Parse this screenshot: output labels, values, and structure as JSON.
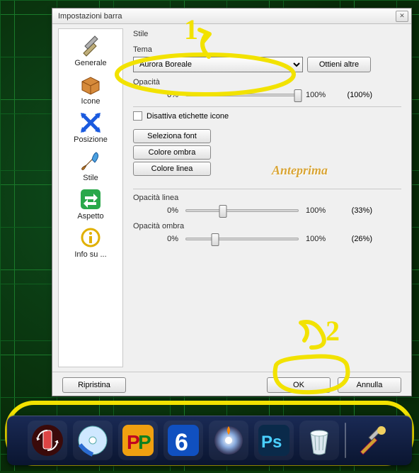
{
  "dialog": {
    "title": "Impostazioni barra",
    "close_glyph": "✕"
  },
  "sidebar": {
    "items": [
      {
        "id": "generale",
        "label": "Generale"
      },
      {
        "id": "icone",
        "label": "Icone"
      },
      {
        "id": "posizione",
        "label": "Posizione"
      },
      {
        "id": "stile",
        "label": "Stile"
      },
      {
        "id": "aspetto",
        "label": "Aspetto"
      },
      {
        "id": "info",
        "label": "Info su ..."
      }
    ]
  },
  "style_panel": {
    "group_title": "Stile",
    "theme_label": "Tema",
    "theme_value": "Aurora Boreale",
    "get_more_label": "Ottieni altre",
    "opacity_label": "Opacità",
    "opacity_0": "0%",
    "opacity_100": "100%",
    "opacity_value_text": "(100%)",
    "opacity_percent": 100,
    "disable_labels_checked": false,
    "disable_labels_text": "Disattiva etichette icone",
    "select_font_label": "Seleziona font",
    "shadow_color_label": "Colore ombra",
    "line_color_label": "Colore linea",
    "preview_text": "Anteprima",
    "line_opacity_label": "Opacità linea",
    "line_opacity_value_text": "(33%)",
    "line_opacity_percent": 33,
    "shadow_opacity_label": "Opacità ombra",
    "shadow_opacity_value_text": "(26%)",
    "shadow_opacity_percent": 26
  },
  "footer": {
    "restore_label": "Ripristina",
    "ok_label": "OK",
    "cancel_label": "Annulla"
  },
  "annotations": {
    "marker_1": "1",
    "marker_2": "2"
  },
  "dock": {
    "items": [
      {
        "id": "phone",
        "name": "phone-sync-icon"
      },
      {
        "id": "disc-blue",
        "name": "disc-blue-icon"
      },
      {
        "id": "pp",
        "name": "pp-app-icon"
      },
      {
        "id": "six",
        "name": "six-app-icon"
      },
      {
        "id": "disc-burn",
        "name": "disc-burn-icon"
      },
      {
        "id": "ps",
        "name": "photoshop-icon"
      },
      {
        "id": "trash",
        "name": "trash-icon"
      },
      {
        "id": "tools",
        "name": "tools-icon"
      }
    ]
  }
}
